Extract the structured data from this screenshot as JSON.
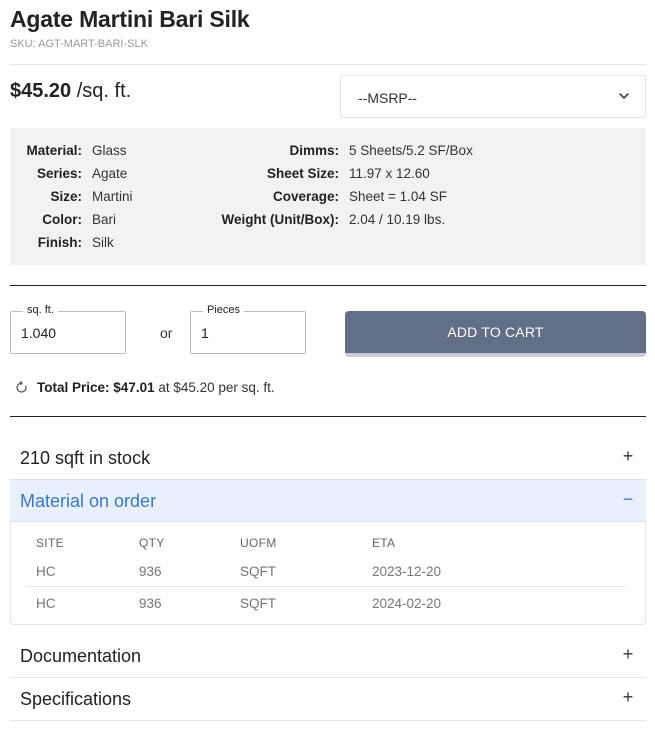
{
  "product": {
    "title": "Agate Martini Bari Silk",
    "sku": "SKU: AGT-MART-BARI-SLK",
    "price": "$45.20",
    "unit": "/sq. ft."
  },
  "msrp_select": {
    "selected": "--MSRP--"
  },
  "specs": {
    "left": [
      {
        "label": "Material:",
        "value": "Glass"
      },
      {
        "label": "Series:",
        "value": "Agate"
      },
      {
        "label": "Size:",
        "value": "Martini"
      },
      {
        "label": "Color:",
        "value": "Bari"
      },
      {
        "label": "Finish:",
        "value": "Silk"
      }
    ],
    "right": [
      {
        "label": "Dimms:",
        "value": "5 Sheets/5.2 SF/Box"
      },
      {
        "label": "Sheet Size:",
        "value": "11.97 x 12.60"
      },
      {
        "label": "Coverage:",
        "value": "Sheet = 1.04 SF"
      },
      {
        "label": "Weight (Unit/Box):",
        "value": "2.04 / 10.19 lbs."
      }
    ]
  },
  "quantity": {
    "sqft_label": "sq. ft.",
    "sqft_value": "1.040",
    "or_text": "or",
    "pieces_label": "Pieces",
    "pieces_value": "1",
    "add_to_cart": "ADD TO CART"
  },
  "total": {
    "label": "Total Price:",
    "amount": "$47.01",
    "suffix": "at $45.20 per sq. ft."
  },
  "accordion": {
    "stock": {
      "title": "210 sqft in stock",
      "symbol": "+"
    },
    "on_order": {
      "title": "Material on order",
      "symbol": "−",
      "columns": [
        "SITE",
        "QTY",
        "UOFM",
        "ETA"
      ],
      "rows": [
        [
          "HC",
          "936",
          "SQFT",
          "2023-12-20"
        ],
        [
          "HC",
          "936",
          "SQFT",
          "2024-02-20"
        ]
      ]
    },
    "documentation": {
      "title": "Documentation",
      "symbol": "+"
    },
    "specifications": {
      "title": "Specifications",
      "symbol": "+"
    }
  },
  "colors": {
    "accent": "#3a78c9",
    "cart_button": "#636e87",
    "open_bg": "#e8f0fd"
  },
  "icons": {
    "select_chevron": "chevron-down-icon",
    "total_spinner": "refresh-icon"
  }
}
